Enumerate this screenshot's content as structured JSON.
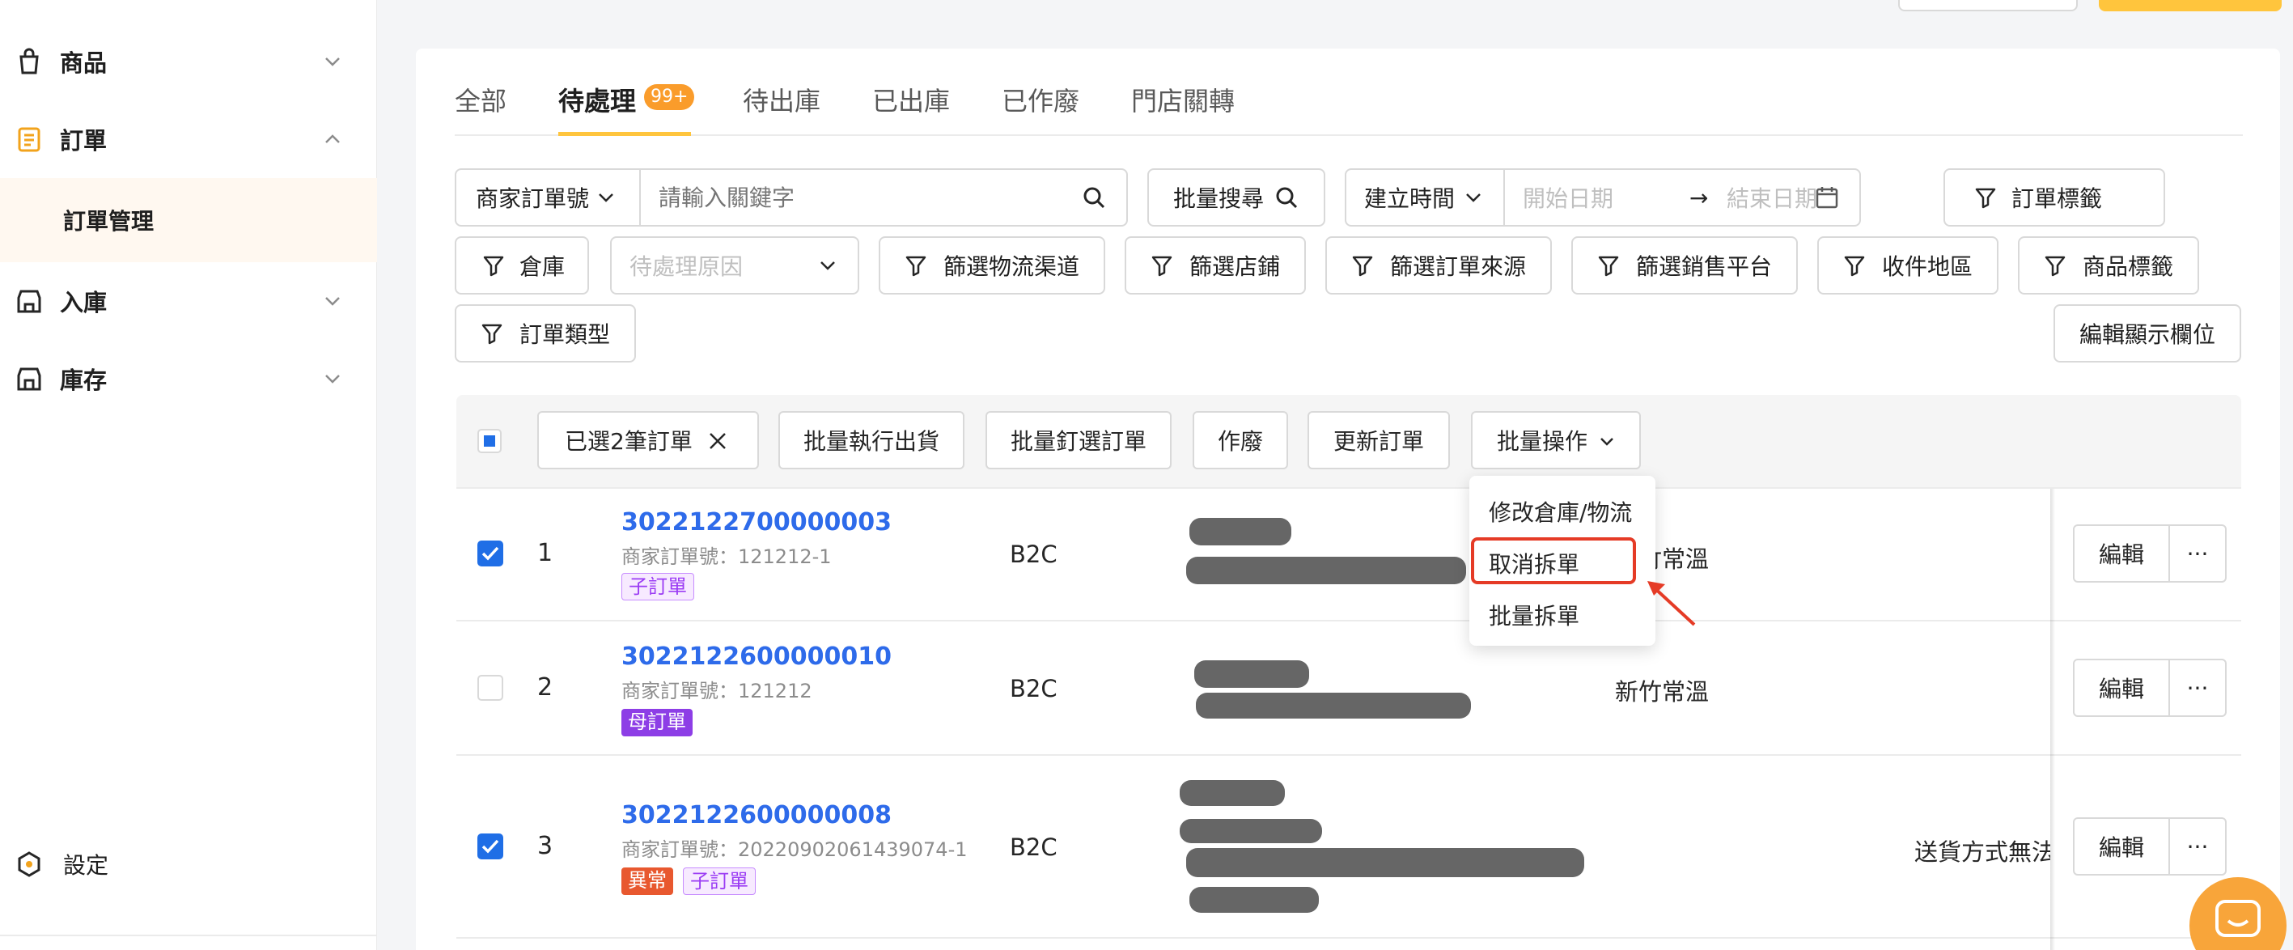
{
  "sidebar": {
    "items": [
      {
        "label": "商品",
        "icon": "bag-icon"
      },
      {
        "label": "訂單",
        "icon": "order-list-icon"
      },
      {
        "label": "入庫",
        "icon": "inbound-store-icon"
      },
      {
        "label": "庫存",
        "icon": "inventory-store-icon"
      }
    ],
    "sub_item": "訂單管理",
    "settings": "設定"
  },
  "tabs": [
    {
      "label": "全部"
    },
    {
      "label": "待處理",
      "badge": "99+",
      "active": true
    },
    {
      "label": "待出庫"
    },
    {
      "label": "已出庫"
    },
    {
      "label": "已作廢"
    },
    {
      "label": "門店關轉"
    }
  ],
  "filters": {
    "search_field": "商家訂單號",
    "search_placeholder": "請輸入關鍵字",
    "batch_search": "批量搜尋",
    "time_field": "建立時間",
    "start_date": "開始日期",
    "end_date": "結束日期",
    "date_arrow": "→",
    "order_tags": "訂單標籤",
    "warehouse": "倉庫",
    "pending_reason": "待處理原因",
    "logistics_channel": "篩選物流渠道",
    "store": "篩選店鋪",
    "order_source": "篩選訂單來源",
    "sales_platform": "篩選銷售平台",
    "receiving_area": "收件地區",
    "product_tags": "商品標籤",
    "order_type": "訂單類型",
    "edit_columns": "編輯顯示欄位"
  },
  "toolbar": {
    "selected": "已選2筆訂單",
    "batch_ship": "批量執行出貨",
    "batch_pick": "批量釘選訂單",
    "void": "作廢",
    "update": "更新訂單",
    "batch_ops": "批量操作"
  },
  "dropdown": {
    "items": [
      "修改倉庫/物流",
      "取消拆單",
      "批量拆單"
    ],
    "highlighted": "取消拆單"
  },
  "rows": [
    {
      "no": "1",
      "order": "3022122700000003",
      "merchant": "商家訂單號：121212-1",
      "tags": [
        "子訂單"
      ],
      "type": "B2C",
      "shipping": "新竹常溫",
      "checked": true
    },
    {
      "no": "2",
      "order": "3022122600000010",
      "merchant": "商家訂單號：121212",
      "tags": [
        "母訂單"
      ],
      "type": "B2C",
      "shipping": "新竹常溫",
      "checked": false
    },
    {
      "no": "3",
      "order": "3022122600000008",
      "merchant": "商家訂單號：20220902061439074-1",
      "tags": [
        "異常",
        "子訂單"
      ],
      "type": "B2C",
      "shipping": "送貨方式無法",
      "checked": true
    }
  ],
  "row_actions": {
    "edit": "編輯",
    "more": "···"
  },
  "colors": {
    "accent": "#ffc53d",
    "link": "#2e6bea",
    "checkbox": "#1f6ee6",
    "highlight": "#e53b26"
  }
}
